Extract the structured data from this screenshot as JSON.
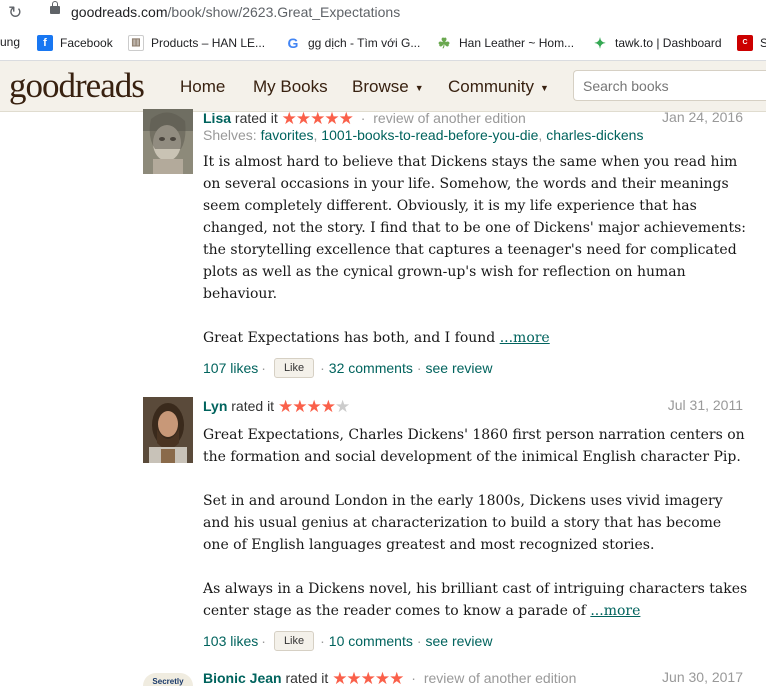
{
  "browser": {
    "url_host": "goodreads.com",
    "url_path": "/book/show/2623.Great_Expectations",
    "bookmarks": [
      {
        "label": "ung",
        "icon": "none",
        "color": "#fff"
      },
      {
        "label": "Facebook",
        "icon": "facebook-icon",
        "color": "#1877f2"
      },
      {
        "label": "Products – HAN LE...",
        "icon": "products-icon",
        "color": "#8a7a6a"
      },
      {
        "label": "gg dịch - Tìm với G...",
        "icon": "google-icon",
        "color": "#4285f4"
      },
      {
        "label": "Han Leather ~ Hom...",
        "icon": "leaf-icon",
        "color": "#6aa84f"
      },
      {
        "label": "tawk.to | Dashboard",
        "icon": "tawk-icon",
        "color": "#34a853"
      },
      {
        "label": "S",
        "icon": "chems-icon",
        "color": "#cc0000"
      }
    ]
  },
  "header": {
    "logo_light": "good",
    "logo_bold": "reads",
    "nav": {
      "home": "Home",
      "my_books": "My Books",
      "browse": "Browse",
      "community": "Community"
    },
    "search_placeholder": "Search books"
  },
  "reviews": [
    {
      "user": "Lisa",
      "rated_it": "rated it",
      "stars": 5,
      "review_of_other": "review of another edition",
      "date": "Jan 24, 2016",
      "shelves_label": "Shelves:",
      "shelves": [
        "favorites",
        "1001-books-to-read-before-you-die",
        "charles-dickens"
      ],
      "paragraphs": [
        "It is almost hard to believe that Dickens stays the same when you read him on several occasions in your life. Somehow, the words and their meanings seem completely different. Obviously, it is my life experience that has changed, not the story. I find that to be one of Dickens' major achievements: the storytelling excellence that captures a teenager's need for complicated plots as well as the cynical grown-up's wish for reflection on human behaviour.",
        "Great Expectations has both, and I found "
      ],
      "more": "...more",
      "likes": "107 likes",
      "like_btn": "Like",
      "comments": "32 comments",
      "see_review": "see review"
    },
    {
      "user": "Lyn",
      "rated_it": "rated it",
      "stars": 4,
      "date": "Jul 31, 2011",
      "paragraphs": [
        "Great Expectations, Charles Dickens' 1860 first person narration centers on the formation and social development of the inimical English character Pip.",
        "Set in and around London in the early 1800s, Dickens uses vivid imagery and his usual genius at characterization to build a story that has become one of English languages greatest and most recognized stories.",
        "As always in a Dickens novel, his brilliant cast of intriguing characters takes center stage as the reader comes to know a parade of "
      ],
      "more": "...more",
      "likes": "103 likes",
      "like_btn": "Like",
      "comments": "10 comments",
      "see_review": "see review"
    },
    {
      "user": "Bionic Jean",
      "rated_it": "rated it",
      "stars": 5,
      "review_of_other": "review of another edition",
      "date": "Jun 30, 2017",
      "avatar_text": "Secretly"
    }
  ]
}
